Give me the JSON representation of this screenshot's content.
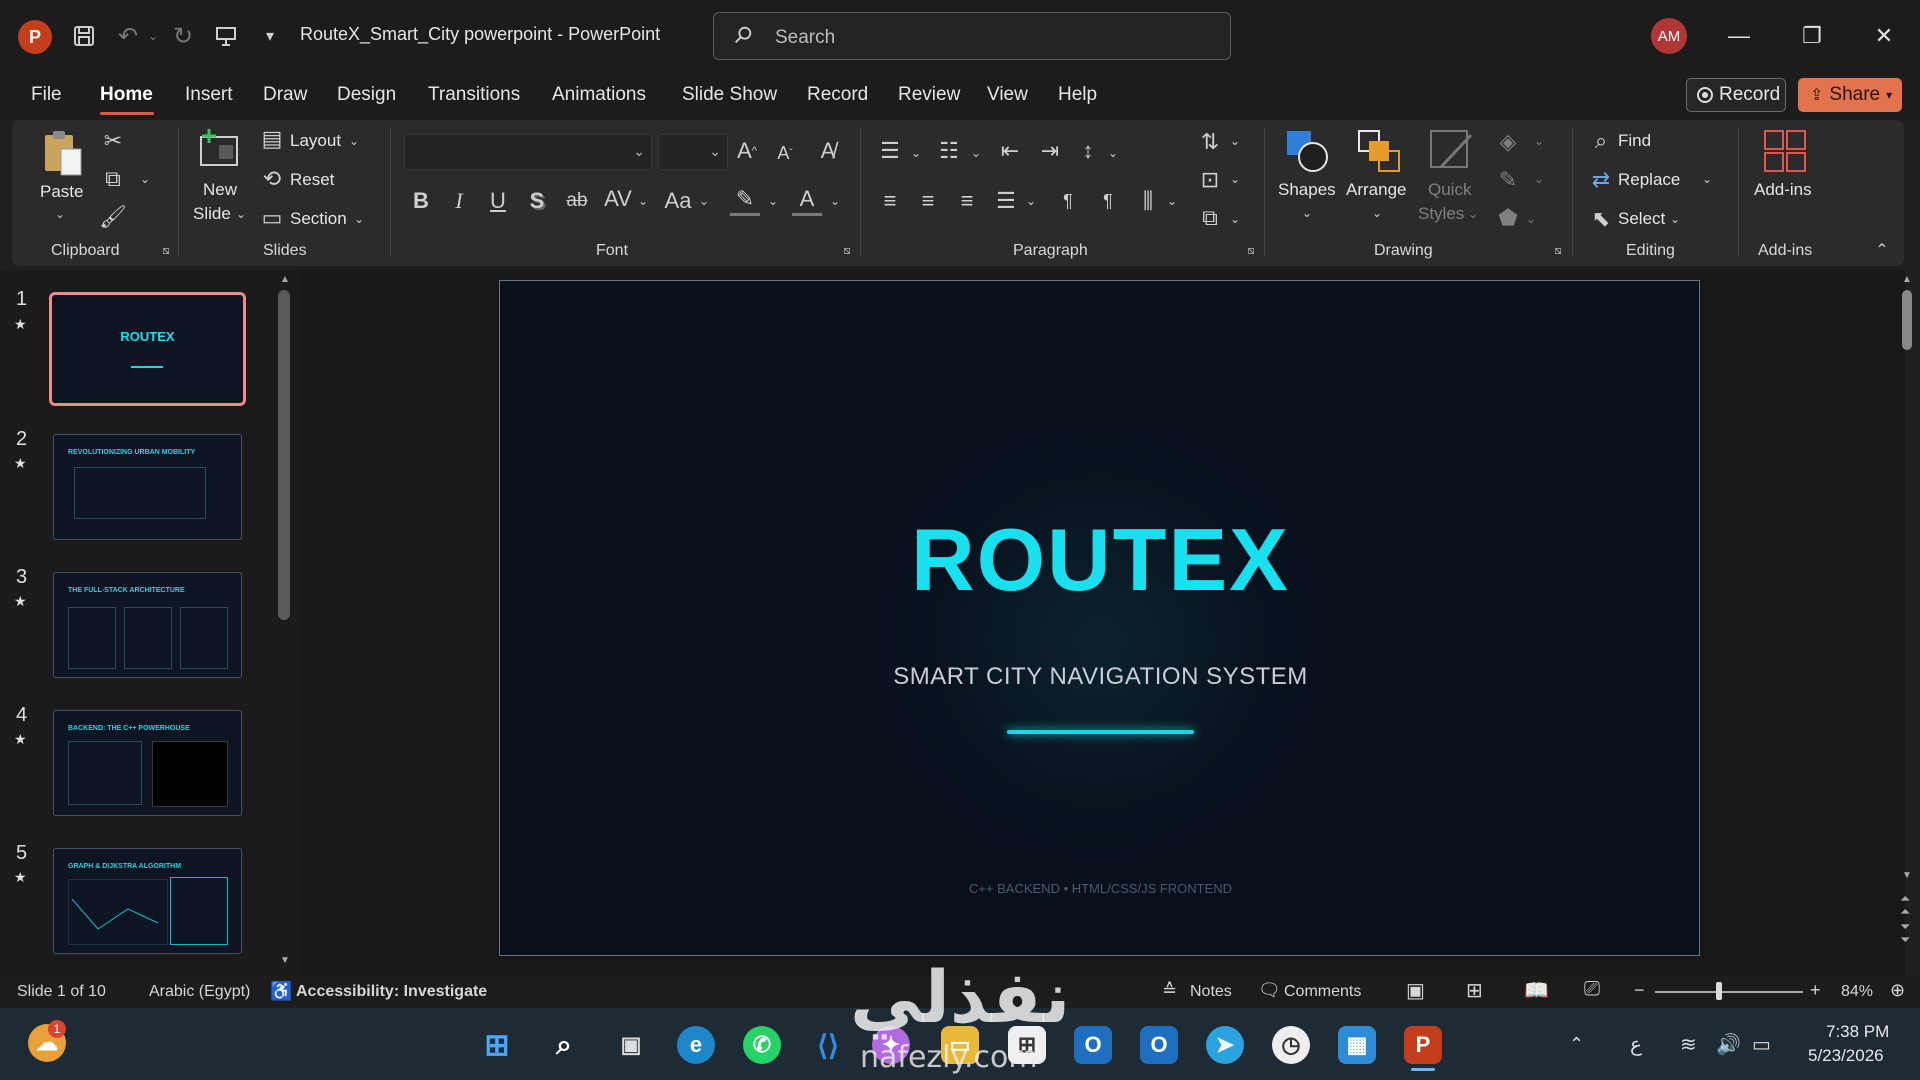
{
  "titlebar": {
    "doc_title": "RouteX_Smart_City powerpoint  -  PowerPoint",
    "search_placeholder": "Search",
    "avatar": "AM"
  },
  "tabs": [
    "File",
    "Home",
    "Insert",
    "Draw",
    "Design",
    "Transitions",
    "Animations",
    "Slide Show",
    "Record",
    "Review",
    "View",
    "Help"
  ],
  "actions": {
    "record": "Record",
    "share": "Share"
  },
  "ribbon": {
    "clipboard": {
      "paste": "Paste",
      "label": "Clipboard"
    },
    "slides": {
      "new_slide_1": "New",
      "new_slide_2": "Slide",
      "layout": "Layout",
      "reset": "Reset",
      "section": "Section",
      "label": "Slides"
    },
    "font": {
      "label": "Font",
      "bold": "B",
      "italic": "I",
      "underline": "U",
      "shadow": "S",
      "strike": "ab",
      "spacing": "AV",
      "case": "Aa"
    },
    "paragraph": {
      "label": "Paragraph"
    },
    "drawing": {
      "shapes": "Shapes",
      "arrange": "Arrange",
      "quick_1": "Quick",
      "quick_2": "Styles",
      "label": "Drawing"
    },
    "editing": {
      "find": "Find",
      "replace": "Replace",
      "select": "Select",
      "label": "Editing"
    },
    "addins": {
      "addins": "Add-ins",
      "label": "Add-ins"
    }
  },
  "thumbnails": [
    {
      "num": "1",
      "title": "ROUTEX"
    },
    {
      "num": "2",
      "title": "REVOLUTIONIZING URBAN MOBILITY"
    },
    {
      "num": "3",
      "title": "THE FULL-STACK ARCHITECTURE"
    },
    {
      "num": "4",
      "title": "BACKEND: THE C++ POWERHOUSE"
    },
    {
      "num": "5",
      "title": "GRAPH & DIJKSTRA ALGORITHM"
    }
  ],
  "slide": {
    "title": "ROUTEX",
    "subtitle": "SMART CITY NAVIGATION SYSTEM",
    "footer": "C++ BACKEND • HTML/CSS/JS FRONTEND"
  },
  "status": {
    "slide_of": "Slide 1 of 10",
    "language": "Arabic (Egypt)",
    "accessibility": "Accessibility: Investigate",
    "notes": "Notes",
    "comments": "Comments",
    "zoom": "84%"
  },
  "taskbar": {
    "notification_count": "1",
    "ime": "ع",
    "time": "7:38 PM",
    "date": "5/23/2026"
  },
  "watermark": {
    "arabic": "نفذلي",
    "latin": "nafezly.com"
  },
  "colors": {
    "accent": "#19e0ee",
    "slide_bg": "#08101c",
    "share": "#e3734a",
    "select_border": "#f08b86"
  }
}
